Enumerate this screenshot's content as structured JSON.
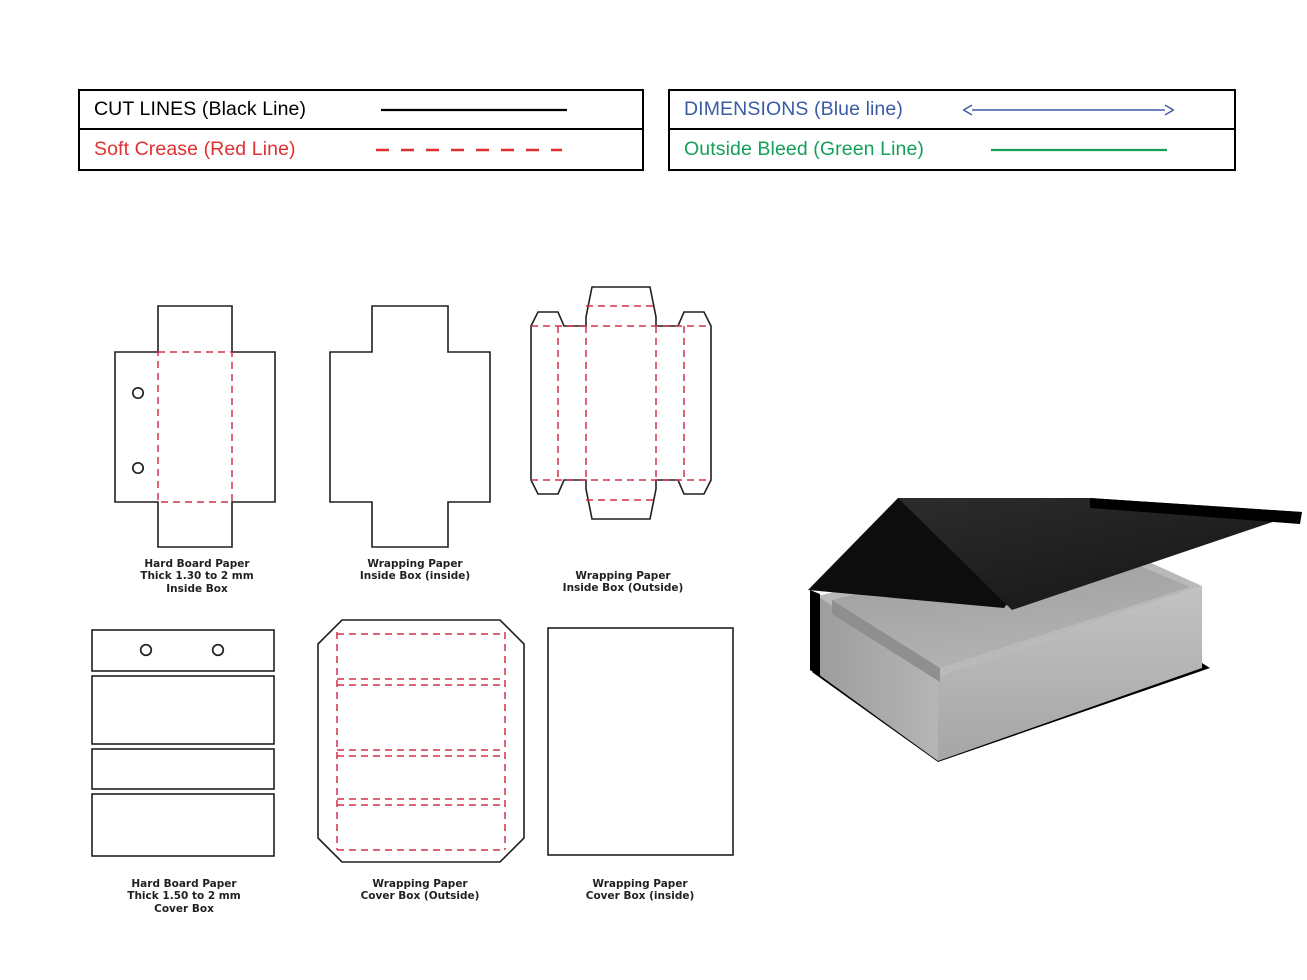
{
  "legend": {
    "left_box": {
      "rows": [
        {
          "label": "CUT LINES (Black Line)",
          "style": "solid-black",
          "color": "#000000"
        },
        {
          "label": "Soft Crease (Red Line)",
          "style": "dashed-red",
          "color": "#e03030"
        }
      ]
    },
    "right_box": {
      "rows": [
        {
          "label": "DIMENSIONS (Blue line)",
          "style": "double-arrow-blue",
          "color": "#3b5ba5"
        },
        {
          "label": "Outside Bleed (Green Line)",
          "style": "solid-green",
          "color": "#15a05a"
        }
      ]
    }
  },
  "figures": [
    {
      "id": "hardboard-inside-box",
      "caption": "Hard Board Paper\nThick 1.30 to 2 mm\nInside Box",
      "material": "Hard Board Paper",
      "thickness": "Thick 1.30 to 2 mm",
      "part": "Inside Box",
      "holes": 2
    },
    {
      "id": "wrapping-inside-box-inside",
      "caption": "Wrapping Paper\nInside Box (inside)",
      "material": "Wrapping Paper",
      "part": "Inside Box (inside)",
      "holes": 0
    },
    {
      "id": "wrapping-inside-box-outside",
      "caption": "Wrapping Paper\nInside Box (Outside)",
      "material": "Wrapping Paper",
      "part": "Inside Box (Outside)",
      "holes": 0
    },
    {
      "id": "hardboard-cover-box",
      "caption": "Hard Board Paper\nThick 1.50 to 2 mm\nCover Box",
      "material": "Hard Board Paper",
      "thickness": "Thick 1.50 to 2 mm",
      "part": "Cover Box",
      "holes": 2,
      "panels": 4
    },
    {
      "id": "wrapping-cover-box-outside",
      "caption": "Wrapping Paper\nCover Box (Outside)",
      "material": "Wrapping Paper",
      "part": "Cover Box (Outside)",
      "holes": 0
    },
    {
      "id": "wrapping-cover-box-inside",
      "caption": "Wrapping Paper\nCover Box (inside)",
      "material": "Wrapping Paper",
      "part": "Cover Box (inside)",
      "holes": 0
    }
  ],
  "preview": {
    "name": "magnetic-closure-gift-box-3d",
    "lid_color": "#1c1c1c",
    "lid_edge_color": "#000000",
    "body_color": "#a9a9a9",
    "body_light_color": "#bdbdbd",
    "body_shadow_color": "#8f8f8f",
    "interior_color": "#9d9d9d",
    "base_color": "#000000"
  },
  "colors": {
    "cut_line": "#231f20",
    "crease_line": "#d4304a",
    "dimension_line": "#3b5ba5",
    "bleed_line": "#15a05a",
    "background": "#ffffff"
  }
}
